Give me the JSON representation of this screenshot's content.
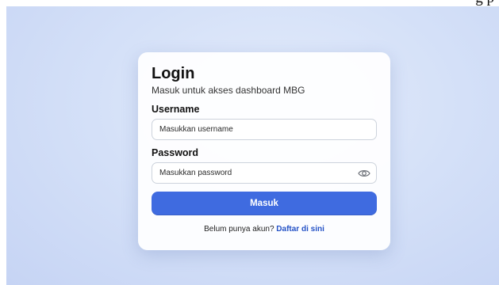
{
  "top_strip": {
    "text": "g  p"
  },
  "login": {
    "title": "Login",
    "subtitle": "Masuk untuk akses dashboard MBG",
    "username_label": "Username",
    "username_placeholder": "Masukkan username",
    "password_label": "Password",
    "password_placeholder": "Masukkan password",
    "show_password_icon": "eye-icon",
    "submit_label": "Masuk",
    "footer_text": "Belum punya akun?",
    "register_link": "Daftar di sini"
  },
  "colors": {
    "accent": "#3f6be0",
    "link": "#2452c6",
    "background": "#d5e1f8"
  }
}
